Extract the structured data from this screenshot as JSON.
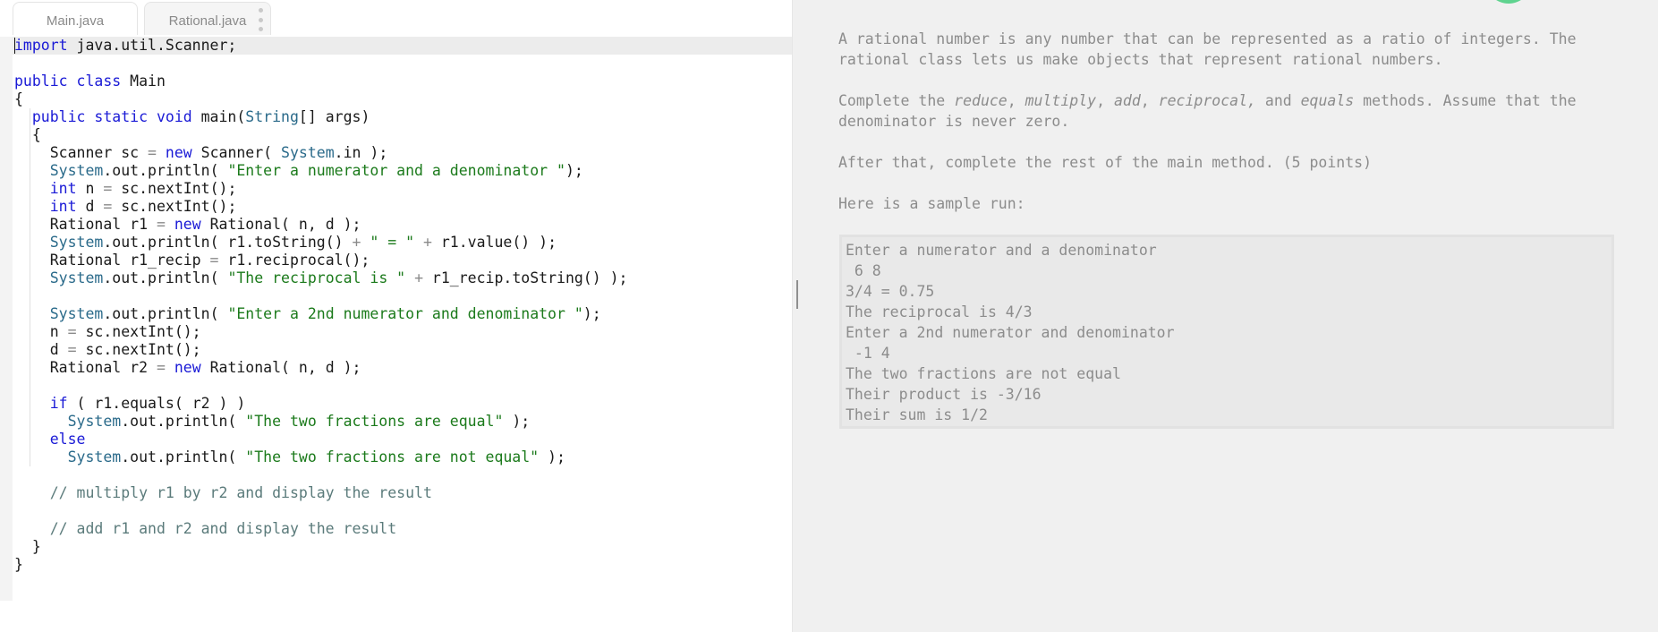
{
  "tabs": [
    {
      "label": "Main.java",
      "active": true
    },
    {
      "label": "Rational.java",
      "active": false
    }
  ],
  "code_lines": [
    [
      {
        "t": "import",
        "c": "kw"
      },
      {
        "t": " java.util.Scanner;",
        "c": ""
      }
    ],
    [],
    [
      {
        "t": "public class",
        "c": "kw"
      },
      {
        "t": " Main",
        "c": ""
      }
    ],
    [
      {
        "t": "{",
        "c": ""
      }
    ],
    [
      {
        "t": "  ",
        "c": ""
      },
      {
        "t": "public static void",
        "c": "kw"
      },
      {
        "t": " main(",
        "c": ""
      },
      {
        "t": "String",
        "c": "cls"
      },
      {
        "t": "[] args)",
        "c": ""
      }
    ],
    [
      {
        "t": "  {",
        "c": ""
      }
    ],
    [
      {
        "t": "    Scanner sc ",
        "c": ""
      },
      {
        "t": "=",
        "c": "op"
      },
      {
        "t": " ",
        "c": ""
      },
      {
        "t": "new",
        "c": "kw"
      },
      {
        "t": " Scanner( ",
        "c": ""
      },
      {
        "t": "System",
        "c": "cls"
      },
      {
        "t": ".in );",
        "c": ""
      }
    ],
    [
      {
        "t": "    ",
        "c": ""
      },
      {
        "t": "System",
        "c": "cls"
      },
      {
        "t": ".out.println( ",
        "c": ""
      },
      {
        "t": "\"Enter a numerator and a denominator \"",
        "c": "str"
      },
      {
        "t": ");",
        "c": ""
      }
    ],
    [
      {
        "t": "    ",
        "c": ""
      },
      {
        "t": "int",
        "c": "kw"
      },
      {
        "t": " n ",
        "c": ""
      },
      {
        "t": "=",
        "c": "op"
      },
      {
        "t": " sc.nextInt();",
        "c": ""
      }
    ],
    [
      {
        "t": "    ",
        "c": ""
      },
      {
        "t": "int",
        "c": "kw"
      },
      {
        "t": " d ",
        "c": ""
      },
      {
        "t": "=",
        "c": "op"
      },
      {
        "t": " sc.nextInt();",
        "c": ""
      }
    ],
    [
      {
        "t": "    Rational r1 ",
        "c": ""
      },
      {
        "t": "=",
        "c": "op"
      },
      {
        "t": " ",
        "c": ""
      },
      {
        "t": "new",
        "c": "kw"
      },
      {
        "t": " Rational( n, d );",
        "c": ""
      }
    ],
    [
      {
        "t": "    ",
        "c": ""
      },
      {
        "t": "System",
        "c": "cls"
      },
      {
        "t": ".out.println( r1.toString() ",
        "c": ""
      },
      {
        "t": "+",
        "c": "op"
      },
      {
        "t": " ",
        "c": ""
      },
      {
        "t": "\" = \"",
        "c": "str"
      },
      {
        "t": " ",
        "c": ""
      },
      {
        "t": "+",
        "c": "op"
      },
      {
        "t": " r1.value() );",
        "c": ""
      }
    ],
    [
      {
        "t": "    Rational r1_recip ",
        "c": ""
      },
      {
        "t": "=",
        "c": "op"
      },
      {
        "t": " r1.reciprocal();",
        "c": ""
      }
    ],
    [
      {
        "t": "    ",
        "c": ""
      },
      {
        "t": "System",
        "c": "cls"
      },
      {
        "t": ".out.println( ",
        "c": ""
      },
      {
        "t": "\"The reciprocal is \"",
        "c": "str"
      },
      {
        "t": " ",
        "c": ""
      },
      {
        "t": "+",
        "c": "op"
      },
      {
        "t": " r1_recip.toString() );",
        "c": ""
      }
    ],
    [],
    [
      {
        "t": "    ",
        "c": ""
      },
      {
        "t": "System",
        "c": "cls"
      },
      {
        "t": ".out.println( ",
        "c": ""
      },
      {
        "t": "\"Enter a 2nd numerator and denominator \"",
        "c": "str"
      },
      {
        "t": ");",
        "c": ""
      }
    ],
    [
      {
        "t": "    n ",
        "c": ""
      },
      {
        "t": "=",
        "c": "op"
      },
      {
        "t": " sc.nextInt();",
        "c": ""
      }
    ],
    [
      {
        "t": "    d ",
        "c": ""
      },
      {
        "t": "=",
        "c": "op"
      },
      {
        "t": " sc.nextInt();",
        "c": ""
      }
    ],
    [
      {
        "t": "    Rational r2 ",
        "c": ""
      },
      {
        "t": "=",
        "c": "op"
      },
      {
        "t": " ",
        "c": ""
      },
      {
        "t": "new",
        "c": "kw"
      },
      {
        "t": " Rational( n, d );",
        "c": ""
      }
    ],
    [],
    [
      {
        "t": "    ",
        "c": ""
      },
      {
        "t": "if",
        "c": "kw"
      },
      {
        "t": " ( r1.equals( r2 ) )",
        "c": ""
      }
    ],
    [
      {
        "t": "      ",
        "c": ""
      },
      {
        "t": "System",
        "c": "cls"
      },
      {
        "t": ".out.println( ",
        "c": ""
      },
      {
        "t": "\"The two fractions are equal\"",
        "c": "str"
      },
      {
        "t": " );",
        "c": ""
      }
    ],
    [
      {
        "t": "    ",
        "c": ""
      },
      {
        "t": "else",
        "c": "kw"
      }
    ],
    [
      {
        "t": "      ",
        "c": ""
      },
      {
        "t": "System",
        "c": "cls"
      },
      {
        "t": ".out.println( ",
        "c": ""
      },
      {
        "t": "\"The two fractions are not equal\"",
        "c": "str"
      },
      {
        "t": " );",
        "c": ""
      }
    ],
    [],
    [
      {
        "t": "    // multiply r1 by r2 and display the result",
        "c": "cm"
      }
    ],
    [],
    [
      {
        "t": "    // add r1 and r2 and display the result",
        "c": "cm"
      }
    ],
    [
      {
        "t": "  }",
        "c": ""
      }
    ],
    [
      {
        "t": "}",
        "c": ""
      }
    ]
  ],
  "instructions": {
    "intro": "A rational number is any number that can be represented as a ratio of integers. The rational class lets us make objects that represent rational numbers.",
    "complete_prefix": "Complete the ",
    "methods": [
      "reduce",
      "multiply",
      "add",
      "reciprocal,",
      "equals"
    ],
    "complete_suffix": " methods. Assume that the denominator is never zero.",
    "after": "After that, complete the rest of the main method. (5 points)",
    "sample_intro": "Here is a sample run:",
    "sample_run": [
      "Enter a numerator and a denominator",
      " 6 8",
      "3/4 = 0.75",
      "The reciprocal is 4/3",
      "Enter a 2nd numerator and denominator",
      " -1 4",
      "The two fractions are not equal",
      "Their product is -3/16",
      "Their sum is 1/2"
    ]
  },
  "colors": {
    "keyword": "#1a1ad6",
    "string": "#1b7a1b",
    "comment": "#5b7b7b",
    "instructions_text": "#8c8c8c",
    "status_circle": "#5fd38f"
  }
}
